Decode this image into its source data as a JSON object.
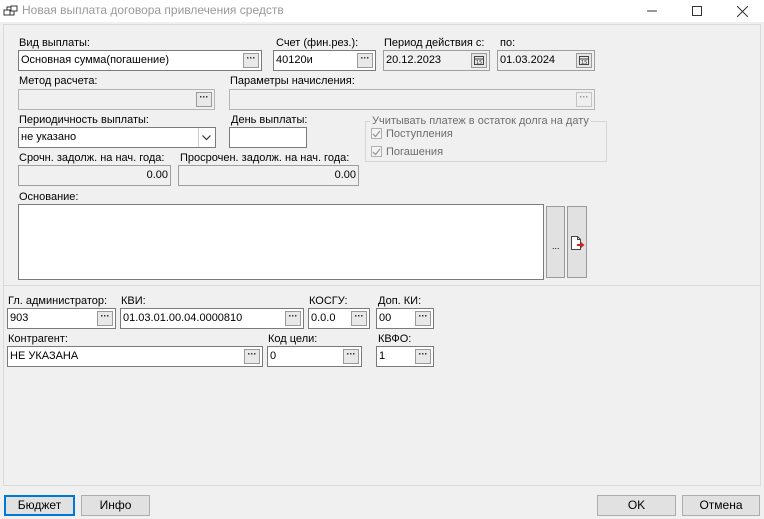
{
  "window": {
    "title": "Новая выплата договора привлечения средств"
  },
  "form": {
    "payment_type": {
      "label": "Вид выплаты:",
      "value": "Основная сумма(погашение)"
    },
    "account": {
      "label": "Счет (фин.рез.):",
      "value": "40120и"
    },
    "period_from": {
      "label": "Период действия с:",
      "value": "20.12.2023"
    },
    "period_to": {
      "label": "по:",
      "value": "01.03.2024"
    },
    "calc_method": {
      "label": "Метод расчета:",
      "value": ""
    },
    "accrual_params": {
      "label": "Параметры начисления:",
      "value": ""
    },
    "periodicity": {
      "label": "Периодичность выплаты:",
      "value": "не указано"
    },
    "payment_day": {
      "label": "День выплаты:",
      "value": ""
    },
    "debt_group": {
      "label": "Учитывать платеж в остаток долга на дату",
      "receipts": "Поступления",
      "repayments": "Погашения"
    },
    "urgent_debt": {
      "label": "Срочн. задолж. на нач. года:",
      "value": "0.00"
    },
    "overdue_debt": {
      "label": "Просрочен. задолж. на нач. года:",
      "value": "0.00"
    },
    "basis": {
      "label": "Основание:",
      "value": "",
      "dots_label": "..."
    }
  },
  "budget": {
    "admin": {
      "label": "Гл. администратор:",
      "value": "903"
    },
    "kvi": {
      "label": "КВИ:",
      "value": "01.03.01.00.04.0000810"
    },
    "kosgu": {
      "label": "КОСГУ:",
      "value": "0.0.0"
    },
    "dop_ki": {
      "label": "Доп. КИ:",
      "value": "00"
    },
    "counterparty": {
      "label": "Контрагент:",
      "value": "НЕ УКАЗАНА"
    },
    "goal_code": {
      "label": "Код цели:",
      "value": "0"
    },
    "kvfo": {
      "label": "КВФО:",
      "value": "1"
    }
  },
  "buttons": {
    "budget": "Бюджет",
    "info": "Инфо",
    "ok": "OK",
    "cancel": "Отмена"
  },
  "colors": {
    "title_text": "#999999",
    "default_button_border": "#0078d7",
    "arrow_red": "#e0201c"
  }
}
